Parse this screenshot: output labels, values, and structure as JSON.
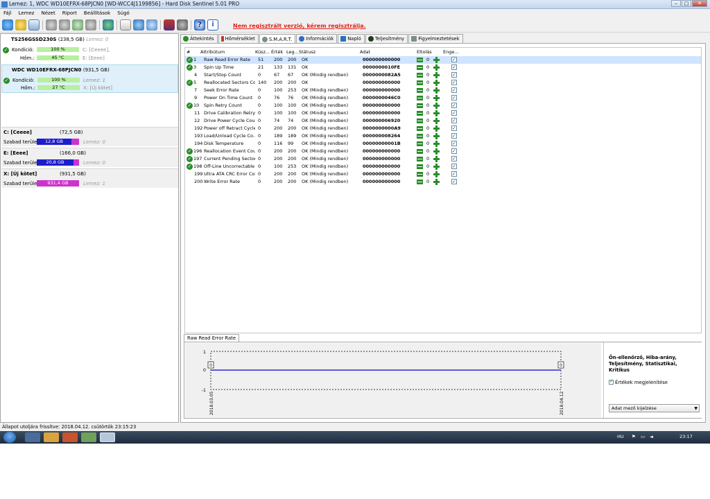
{
  "window": {
    "title": "Lemez: 1, WDC WD10EFRX-68PJCN0 [WD-WCC4J1199856]  -  Hard Disk Sentinel 5.01 PRO",
    "controls": [
      "minimize",
      "maximize",
      "close"
    ]
  },
  "menu": [
    "Fájl",
    "Lemez",
    "Nézet",
    "Riport",
    "Beállítások",
    "Súgó"
  ],
  "registration_note": "Nem regisztrált verzió, kérem regisztrálja.",
  "toolbar_icons": [
    "refresh-icon",
    "warning-icon",
    "report-icon",
    "tool1-icon",
    "tool2-icon",
    "tool3-icon",
    "tool4-icon",
    "globe-icon",
    "doc-icon",
    "network-icon",
    "cloud-icon",
    "monitor-icon",
    "settings-icon",
    "help-icon",
    "info-icon"
  ],
  "disks": [
    {
      "name": "TS256GSSD230S",
      "size": "(238,5 GB)",
      "disk_no": "Lemez: 0",
      "condition_label": "Kondíció:",
      "condition": "100 %",
      "condition_level": 1.0,
      "temp_label": "Hőm.:",
      "temp": "45 °C",
      "drives": [
        "C: [Ceeee],",
        "E: [Eeee]"
      ]
    },
    {
      "name": "WDC WD10EFRX-68PJCN0",
      "size": "(931,5 GB)",
      "disk_no": "Lemez: 1",
      "condition_label": "Kondíció:",
      "condition": "100 %",
      "condition_level": 1.0,
      "temp_label": "Hőm.:",
      "temp": "27 °C",
      "drives": [
        "X: [Új kötet]"
      ]
    }
  ],
  "partitions": [
    {
      "name": "C: [Ceeee]",
      "size": "(72,5 GB)",
      "free_label": "Szabad terület",
      "free": "12,8 GB",
      "free_fraction": 0.18,
      "disk_no": "Lemez: 0"
    },
    {
      "name": "E: [Eeee]",
      "size": "(166,0 GB)",
      "free_label": "Szabad terület",
      "free": "20,8 GB",
      "free_fraction": 0.13,
      "disk_no": "Lemez: 0"
    },
    {
      "name": "X: [Új kötet]",
      "size": "(931,5 GB)",
      "free_label": "Szabad terület",
      "free": "931,4 GB",
      "free_fraction": 1.0,
      "disk_no": "Lemez: 1"
    }
  ],
  "tabs": [
    {
      "label": "Áttekintés",
      "icon": "check-icon",
      "color": "#2a8d2a"
    },
    {
      "label": "Hőmérséklet",
      "icon": "thermometer-icon",
      "color": "#c0392b"
    },
    {
      "label": "S.M.A.R.T.",
      "icon": "smart-icon",
      "color": "#7f8c8d",
      "active": true
    },
    {
      "label": "Információk",
      "icon": "info-icon",
      "color": "#2e6fc0"
    },
    {
      "label": "Napló",
      "icon": "log-icon",
      "color": "#2e6fc0"
    },
    {
      "label": "Teljesítmény",
      "icon": "performance-icon",
      "color": "#2a8d2a"
    },
    {
      "label": "Figyelmeztetések",
      "icon": "alert-icon",
      "color": "#7f8c8d"
    }
  ],
  "smart": {
    "columns": [
      "#",
      "Attribútum",
      "Küsz...",
      "Érték",
      "Leg...",
      "Státusz",
      "Adat",
      "Eltolás",
      "Enge..."
    ],
    "offset_value": "0",
    "rows": [
      {
        "id": "1",
        "attr": "Raw Read Error Rate",
        "thr": "51",
        "val": "200",
        "worst": "200",
        "status": "OK",
        "data": "000000000000",
        "ok_icon": true,
        "selected": true
      },
      {
        "id": "3",
        "attr": "Spin Up Time",
        "thr": "21",
        "val": "133",
        "worst": "131",
        "status": "OK",
        "data": "0000000010FE",
        "ok_icon": true
      },
      {
        "id": "4",
        "attr": "Start/Stop Count",
        "thr": "0",
        "val": "67",
        "worst": "67",
        "status": "OK (Mindig rendben)",
        "data": "0000000082A5",
        "ok_icon": false
      },
      {
        "id": "5",
        "attr": "Reallocated Sectors Co...",
        "thr": "140",
        "val": "200",
        "worst": "200",
        "status": "OK",
        "data": "000000000000",
        "ok_icon": true
      },
      {
        "id": "7",
        "attr": "Seek Error Rate",
        "thr": "0",
        "val": "100",
        "worst": "253",
        "status": "OK (Mindig rendben)",
        "data": "000000000000",
        "ok_icon": false
      },
      {
        "id": "9",
        "attr": "Power On Time Count",
        "thr": "0",
        "val": "76",
        "worst": "76",
        "status": "OK (Mindig rendben)",
        "data": "0000000046C0",
        "ok_icon": false
      },
      {
        "id": "10",
        "attr": "Spin Retry Count",
        "thr": "0",
        "val": "100",
        "worst": "100",
        "status": "OK (Mindig rendben)",
        "data": "000000000000",
        "ok_icon": true
      },
      {
        "id": "11",
        "attr": "Drive Calibration Retry ...",
        "thr": "0",
        "val": "100",
        "worst": "100",
        "status": "OK (Mindig rendben)",
        "data": "000000000000",
        "ok_icon": false
      },
      {
        "id": "12",
        "attr": "Drive Power Cycle Count",
        "thr": "0",
        "val": "74",
        "worst": "74",
        "status": "OK (Mindig rendben)",
        "data": "000000006920",
        "ok_icon": false
      },
      {
        "id": "192",
        "attr": "Power off Retract Cycle ...",
        "thr": "0",
        "val": "200",
        "worst": "200",
        "status": "OK (Mindig rendben)",
        "data": "0000000000A9",
        "ok_icon": false
      },
      {
        "id": "193",
        "attr": "Load/Unload Cycle Co...",
        "thr": "0",
        "val": "189",
        "worst": "189",
        "status": "OK (Mindig rendben)",
        "data": "000000008264",
        "ok_icon": false
      },
      {
        "id": "194",
        "attr": "Disk Temperature",
        "thr": "0",
        "val": "116",
        "worst": "99",
        "status": "OK (Mindig rendben)",
        "data": "00000000001B",
        "ok_icon": false
      },
      {
        "id": "196",
        "attr": "Reallocation Event Count",
        "thr": "0",
        "val": "200",
        "worst": "200",
        "status": "OK (Mindig rendben)",
        "data": "000000000000",
        "ok_icon": true
      },
      {
        "id": "197",
        "attr": "Current Pending Sector...",
        "thr": "0",
        "val": "200",
        "worst": "200",
        "status": "OK (Mindig rendben)",
        "data": "000000000000",
        "ok_icon": true
      },
      {
        "id": "198",
        "attr": "Off-Line Uncorrectable ...",
        "thr": "0",
        "val": "100",
        "worst": "253",
        "status": "OK (Mindig rendben)",
        "data": "000000000000",
        "ok_icon": true
      },
      {
        "id": "199",
        "attr": "Ultra ATA CRC Error Co...",
        "thr": "0",
        "val": "200",
        "worst": "200",
        "status": "OK (Mindig rendben)",
        "data": "000000000000",
        "ok_icon": false
      },
      {
        "id": "200",
        "attr": "Write Error Rate",
        "thr": "0",
        "val": "200",
        "worst": "200",
        "status": "OK (Mindig rendben)",
        "data": "000000000000",
        "ok_icon": false
      }
    ]
  },
  "graph": {
    "tab_label": "Raw Read Error Rate",
    "y_ticks": [
      "1",
      "0",
      "-1"
    ],
    "start_label": "0",
    "end_label": "0",
    "x_start": "2018.03.05",
    "x_end": "2018.04.12",
    "line_color": "#2a2ad0",
    "options_title": "Ön-ellenőrző, Hiba-arány, Teljesítmény, Statisztikai, Kritikus",
    "show_values_label": "Értékek megjelenítése",
    "show_values_checked": true,
    "select_label": "Adat mező kijelzése"
  },
  "statusbar": "Állapot utoljára frissítve: 2018.04.12. csütörtök 23:15:23",
  "taskbar": {
    "language": "HU",
    "time": "23:17"
  }
}
